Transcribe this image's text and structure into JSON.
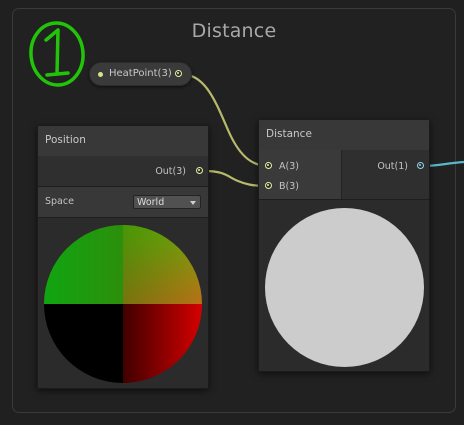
{
  "group": {
    "title": "Distance"
  },
  "annotation": {
    "text": "1",
    "color": "#22c40a"
  },
  "property": {
    "label": "HeatPoint(3)"
  },
  "position_node": {
    "title": "Position",
    "output": "Out(3)",
    "space_label": "Space",
    "space_value": "World"
  },
  "distance_node": {
    "title": "Distance",
    "input_a": "A(3)",
    "input_b": "B(3)",
    "output": "Out(1)",
    "preview_color": "#cccccc"
  },
  "colors": {
    "vector3_port": "#e8ef9e",
    "vector1_port": "#8fd6e8",
    "vector3_wire": "#b7b96c",
    "vector1_wire": "#59b7c9"
  }
}
